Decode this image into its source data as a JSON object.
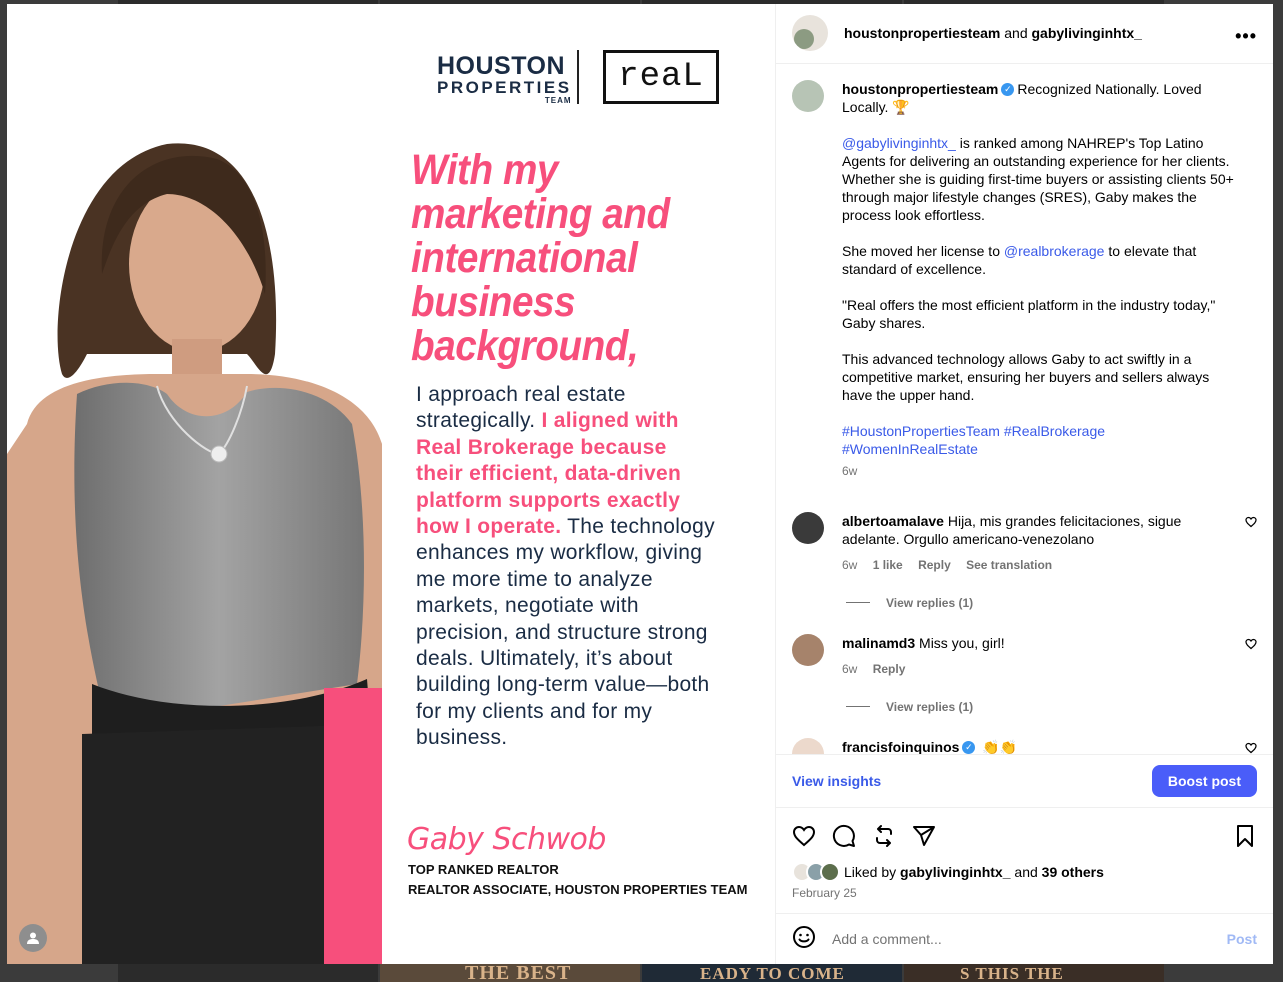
{
  "header": {
    "user1": "houstonpropertiesteam",
    "and": "and",
    "user2": "gabylivinginhtx_",
    "more_icon": "more-horizontal-icon"
  },
  "image": {
    "logo_houston_line1": "HOUSTON",
    "logo_houston_line2": "PROPERTIES",
    "logo_houston_line3": "TEAM",
    "logo_real": "reaL",
    "headline": [
      "With my",
      "marketing and",
      "international",
      "business",
      "background,"
    ],
    "quote_part1": "I approach real estate strategically. ",
    "quote_highlight": "I aligned with Real Brokerage because their efficient, data-driven platform supports exactly how I operate.",
    "quote_part2": " The technology enhances my workflow, giving me more time to analyze markets, negotiate with precision, and structure strong deals. Ultimately, it’s about building long-term value—both for my clients and for my business.",
    "signature_name": "Gaby Schwob",
    "signature_role1": "TOP RANKED REALTOR",
    "signature_role2": "REALTOR ASSOCIATE, HOUSTON PROPERTIES TEAM"
  },
  "caption": {
    "username": "houstonpropertiesteam",
    "intro": "Recognized Nationally. Loved Locally. 🏆",
    "mention1": "@gabylivinginhtx_",
    "para1_rest": " is ranked among NAHREP's Top Latino Agents for delivering an outstanding experience for her clients. Whether she is guiding first-time buyers or assisting clients 50+ through major lifestyle changes (SRES), Gaby makes the process look effortless.",
    "para2_a": "She moved her license to ",
    "mention2": "@realbrokerage",
    "para2_b": " to elevate that standard of excellence.",
    "para3": "\"Real offers the most efficient platform in the industry today,\" Gaby shares.",
    "para4": "This advanced technology allows Gaby to act swiftly in a competitive market, ensuring her buyers and sellers always have the upper hand.",
    "hashtags": "#HoustonPropertiesTeam #RealBrokerage #WomenInRealEstate",
    "time": "6w"
  },
  "comments": [
    {
      "username": "albertoamalave",
      "text": "Hija, mis grandes felicitaciones, sigue adelante. Orgullo americano-venezolano",
      "time": "6w",
      "likes": "1 like",
      "reply": "Reply",
      "translate": "See translation",
      "view_replies": "View replies (1)"
    },
    {
      "username": "malinamd3",
      "text": "Miss you, girl!",
      "time": "6w",
      "reply": "Reply",
      "view_replies": "View replies (1)"
    },
    {
      "username": "francisfoinquinos",
      "text": "👏👏"
    }
  ],
  "insights": {
    "view_insights": "View insights",
    "boost": "Boost post"
  },
  "likes": {
    "prefix": "Liked by",
    "user": "gabylivinginhtx_",
    "and": "and",
    "others": "39 others",
    "date": "February 25"
  },
  "add_comment": {
    "placeholder": "Add a comment...",
    "post": "Post"
  },
  "background": {
    "tile1": "THE BEST",
    "tile2": "EADY TO COME",
    "tile3": "S THIS THE"
  },
  "colors": {
    "accent_pink": "#f74f7c",
    "navy": "#1a2c44",
    "link_blue": "#3a5ae8",
    "boost_blue": "#4a5df9"
  }
}
